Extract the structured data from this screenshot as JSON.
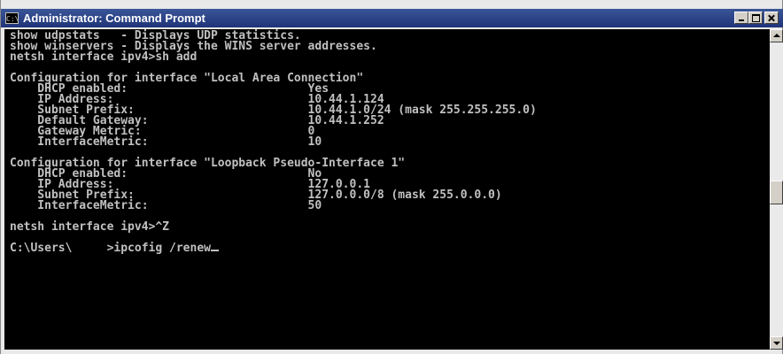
{
  "window": {
    "title": "Administrator: Command Prompt",
    "icon_label": "C:\\"
  },
  "controls": {
    "minimize": "minimize-icon",
    "maximize": "maximize-icon",
    "close": "close-icon"
  },
  "console": {
    "lines": [
      "show udpstats   - Displays UDP statistics.",
      "show winservers - Displays the WINS server addresses.",
      "netsh interface ipv4>sh add",
      "",
      "Configuration for interface \"Local Area Connection\"",
      "    DHCP enabled:                          Yes",
      "    IP Address:                            10.44.1.124",
      "    Subnet Prefix:                         10.44.1.0/24 (mask 255.255.255.0)",
      "    Default Gateway:                       10.44.1.252",
      "    Gateway Metric:                        0",
      "    InterfaceMetric:                       10",
      "",
      "Configuration for interface \"Loopback Pseudo-Interface 1\"",
      "    DHCP enabled:                          No",
      "    IP Address:                            127.0.0.1",
      "    Subnet Prefix:                         127.0.0.0/8 (mask 255.0.0.0)",
      "    InterfaceMetric:                       50",
      "",
      "netsh interface ipv4>^Z",
      "",
      "C:\\Users\\     >ipcofig /renew"
    ]
  },
  "scrollbar": {
    "up": "arrow-up-icon",
    "down": "arrow-down-icon"
  }
}
